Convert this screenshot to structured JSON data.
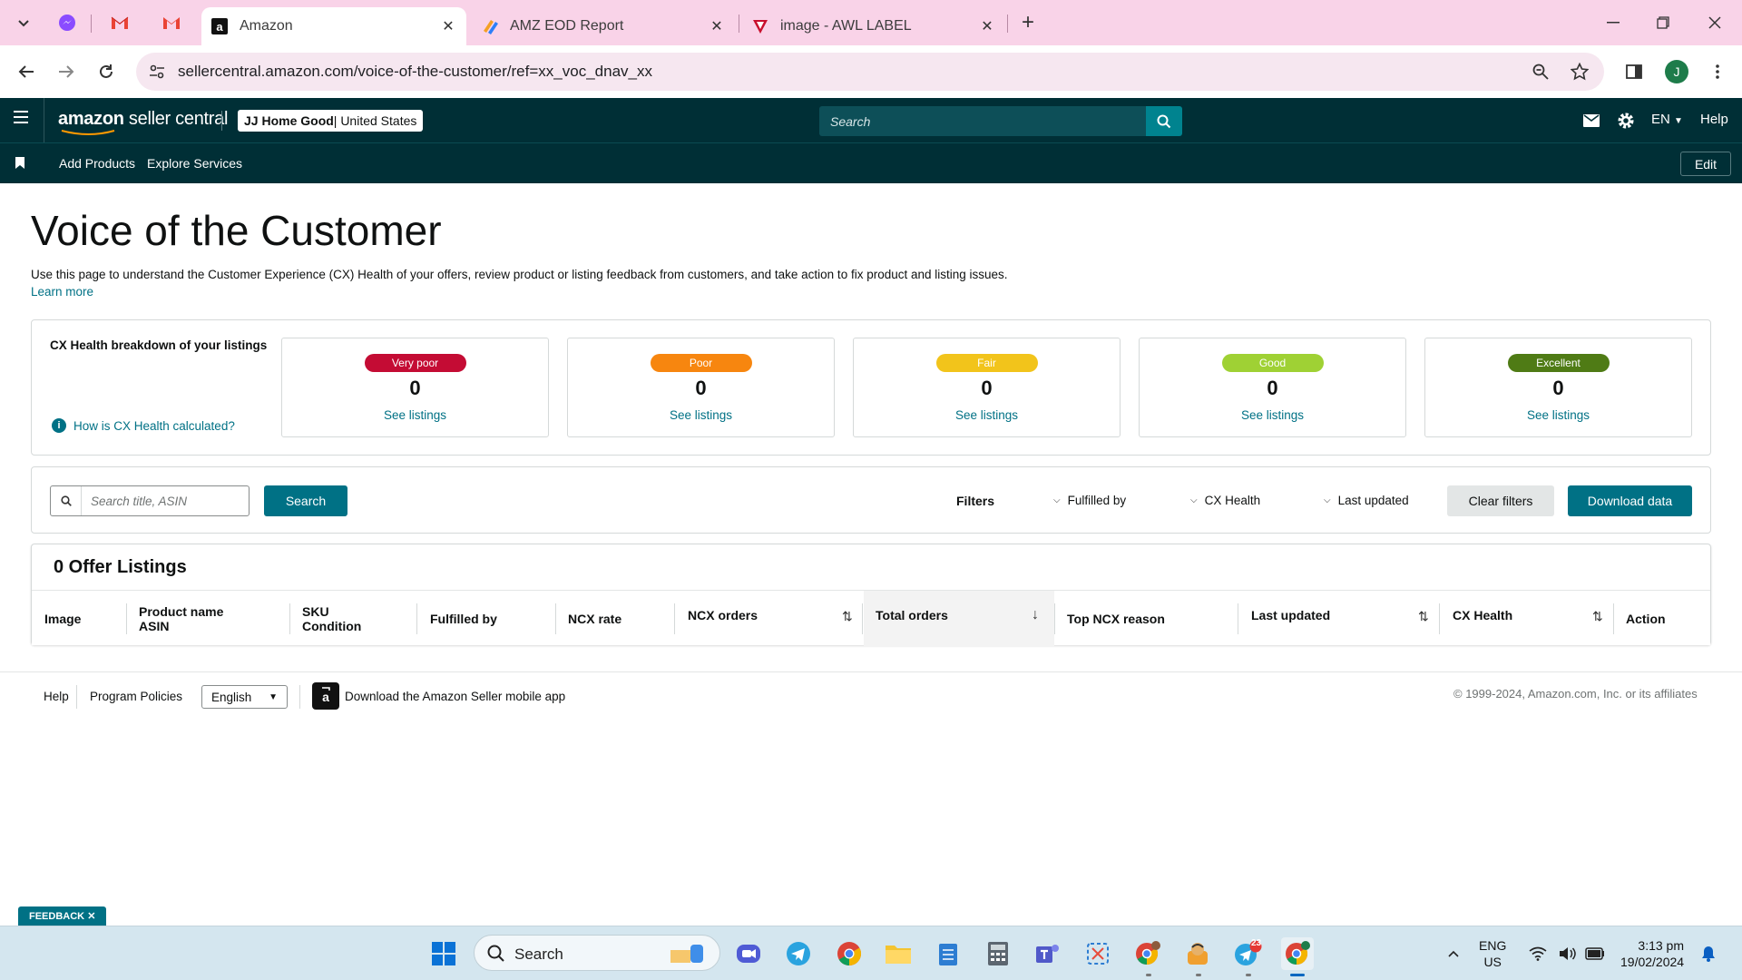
{
  "browser": {
    "tabs": [
      {
        "title": "Amazon",
        "active": true
      },
      {
        "title": "AMZ EOD Report",
        "active": false
      },
      {
        "title": "image - AWL LABEL",
        "active": false
      }
    ],
    "url": "sellercentral.amazon.com/voice-of-the-customer/ref=xx_voc_dnav_xx",
    "profile_initial": "J"
  },
  "header": {
    "logo_prefix": "amazon",
    "logo_suffix": " seller central",
    "store_name": "JJ Home Good",
    "store_region": " | United States",
    "search_placeholder": "Search",
    "language": "EN",
    "help": "Help"
  },
  "subnav": {
    "links": [
      "Add Products",
      "Explore Services"
    ],
    "edit": "Edit"
  },
  "page": {
    "title": "Voice of the Customer",
    "intro": "Use this page to understand the Customer Experience (CX) Health of your offers, review product or listing feedback from customers, and take action to fix product and listing issues.",
    "learn_more": "Learn more"
  },
  "cx_health": {
    "heading": "CX Health breakdown of your listings",
    "how_link": "How is CX Health calculated?",
    "buckets": [
      {
        "label": "Very poor",
        "count": "0",
        "link": "See listings",
        "color": "#c40c34"
      },
      {
        "label": "Poor",
        "count": "0",
        "link": "See listings",
        "color": "#f7860f"
      },
      {
        "label": "Fair",
        "count": "0",
        "link": "See listings",
        "color": "#f2c41b"
      },
      {
        "label": "Good",
        "count": "0",
        "link": "See listings",
        "color": "#9fd134"
      },
      {
        "label": "Excellent",
        "count": "0",
        "link": "See listings",
        "color": "#4f7b15"
      }
    ]
  },
  "filters": {
    "search_placeholder": "Search title, ASIN",
    "search_button": "Search",
    "label": "Filters",
    "dropdowns": [
      "Fulfilled by",
      "CX Health",
      "Last updated"
    ],
    "clear": "Clear filters",
    "download": "Download data"
  },
  "offers": {
    "title": "0 Offer Listings",
    "columns": [
      {
        "line1": "Image",
        "line2": ""
      },
      {
        "line1": "Product name",
        "line2": "ASIN"
      },
      {
        "line1": "SKU",
        "line2": "Condition"
      },
      {
        "line1": "Fulfilled by",
        "line2": ""
      },
      {
        "line1": "NCX rate",
        "line2": ""
      },
      {
        "line1": "NCX orders",
        "line2": ""
      },
      {
        "line1": "Total orders",
        "line2": ""
      },
      {
        "line1": "Top NCX reason",
        "line2": ""
      },
      {
        "line1": "Last updated",
        "line2": ""
      },
      {
        "line1": "CX Health",
        "line2": ""
      },
      {
        "line1": "Action",
        "line2": ""
      }
    ]
  },
  "footer": {
    "help": "Help",
    "policies": "Program Policies",
    "language": "English",
    "app_text": "Download the Amazon Seller mobile app",
    "copyright": "© 1999-2024, Amazon.com, Inc. or its affiliates"
  },
  "feedback": "FEEDBACK",
  "taskbar": {
    "search": "Search",
    "telegram_badge": "23",
    "lang_top": "ENG",
    "lang_bottom": "US",
    "time": "3:13 pm",
    "date": "19/02/2024"
  },
  "colors": {
    "header_bg": "#002f36",
    "accent": "#007185",
    "tab_strip": "#f9d3e8"
  }
}
